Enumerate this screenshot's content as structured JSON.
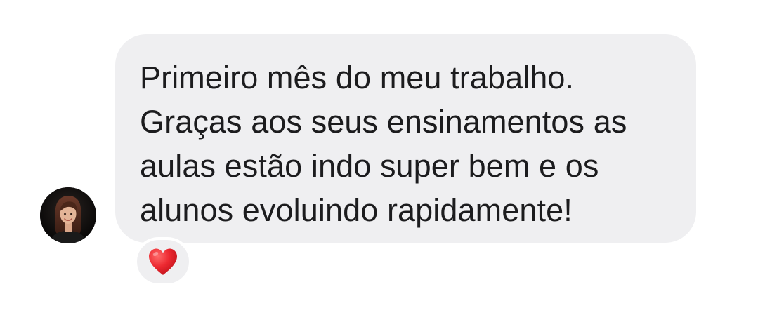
{
  "message": {
    "text": "Primeiro mês do meu trabalho.\nGraças aos seus ensinamentos as\naulas estão indo super bem e os\nalunos evoluindo rapidamente!",
    "bubble_color": "#efeff1",
    "text_color": "#1c1c1e"
  },
  "sender": {
    "avatar_icon": "person-photo-avatar"
  },
  "reaction": {
    "icon": "red-heart-icon",
    "color": "#e8202a"
  }
}
